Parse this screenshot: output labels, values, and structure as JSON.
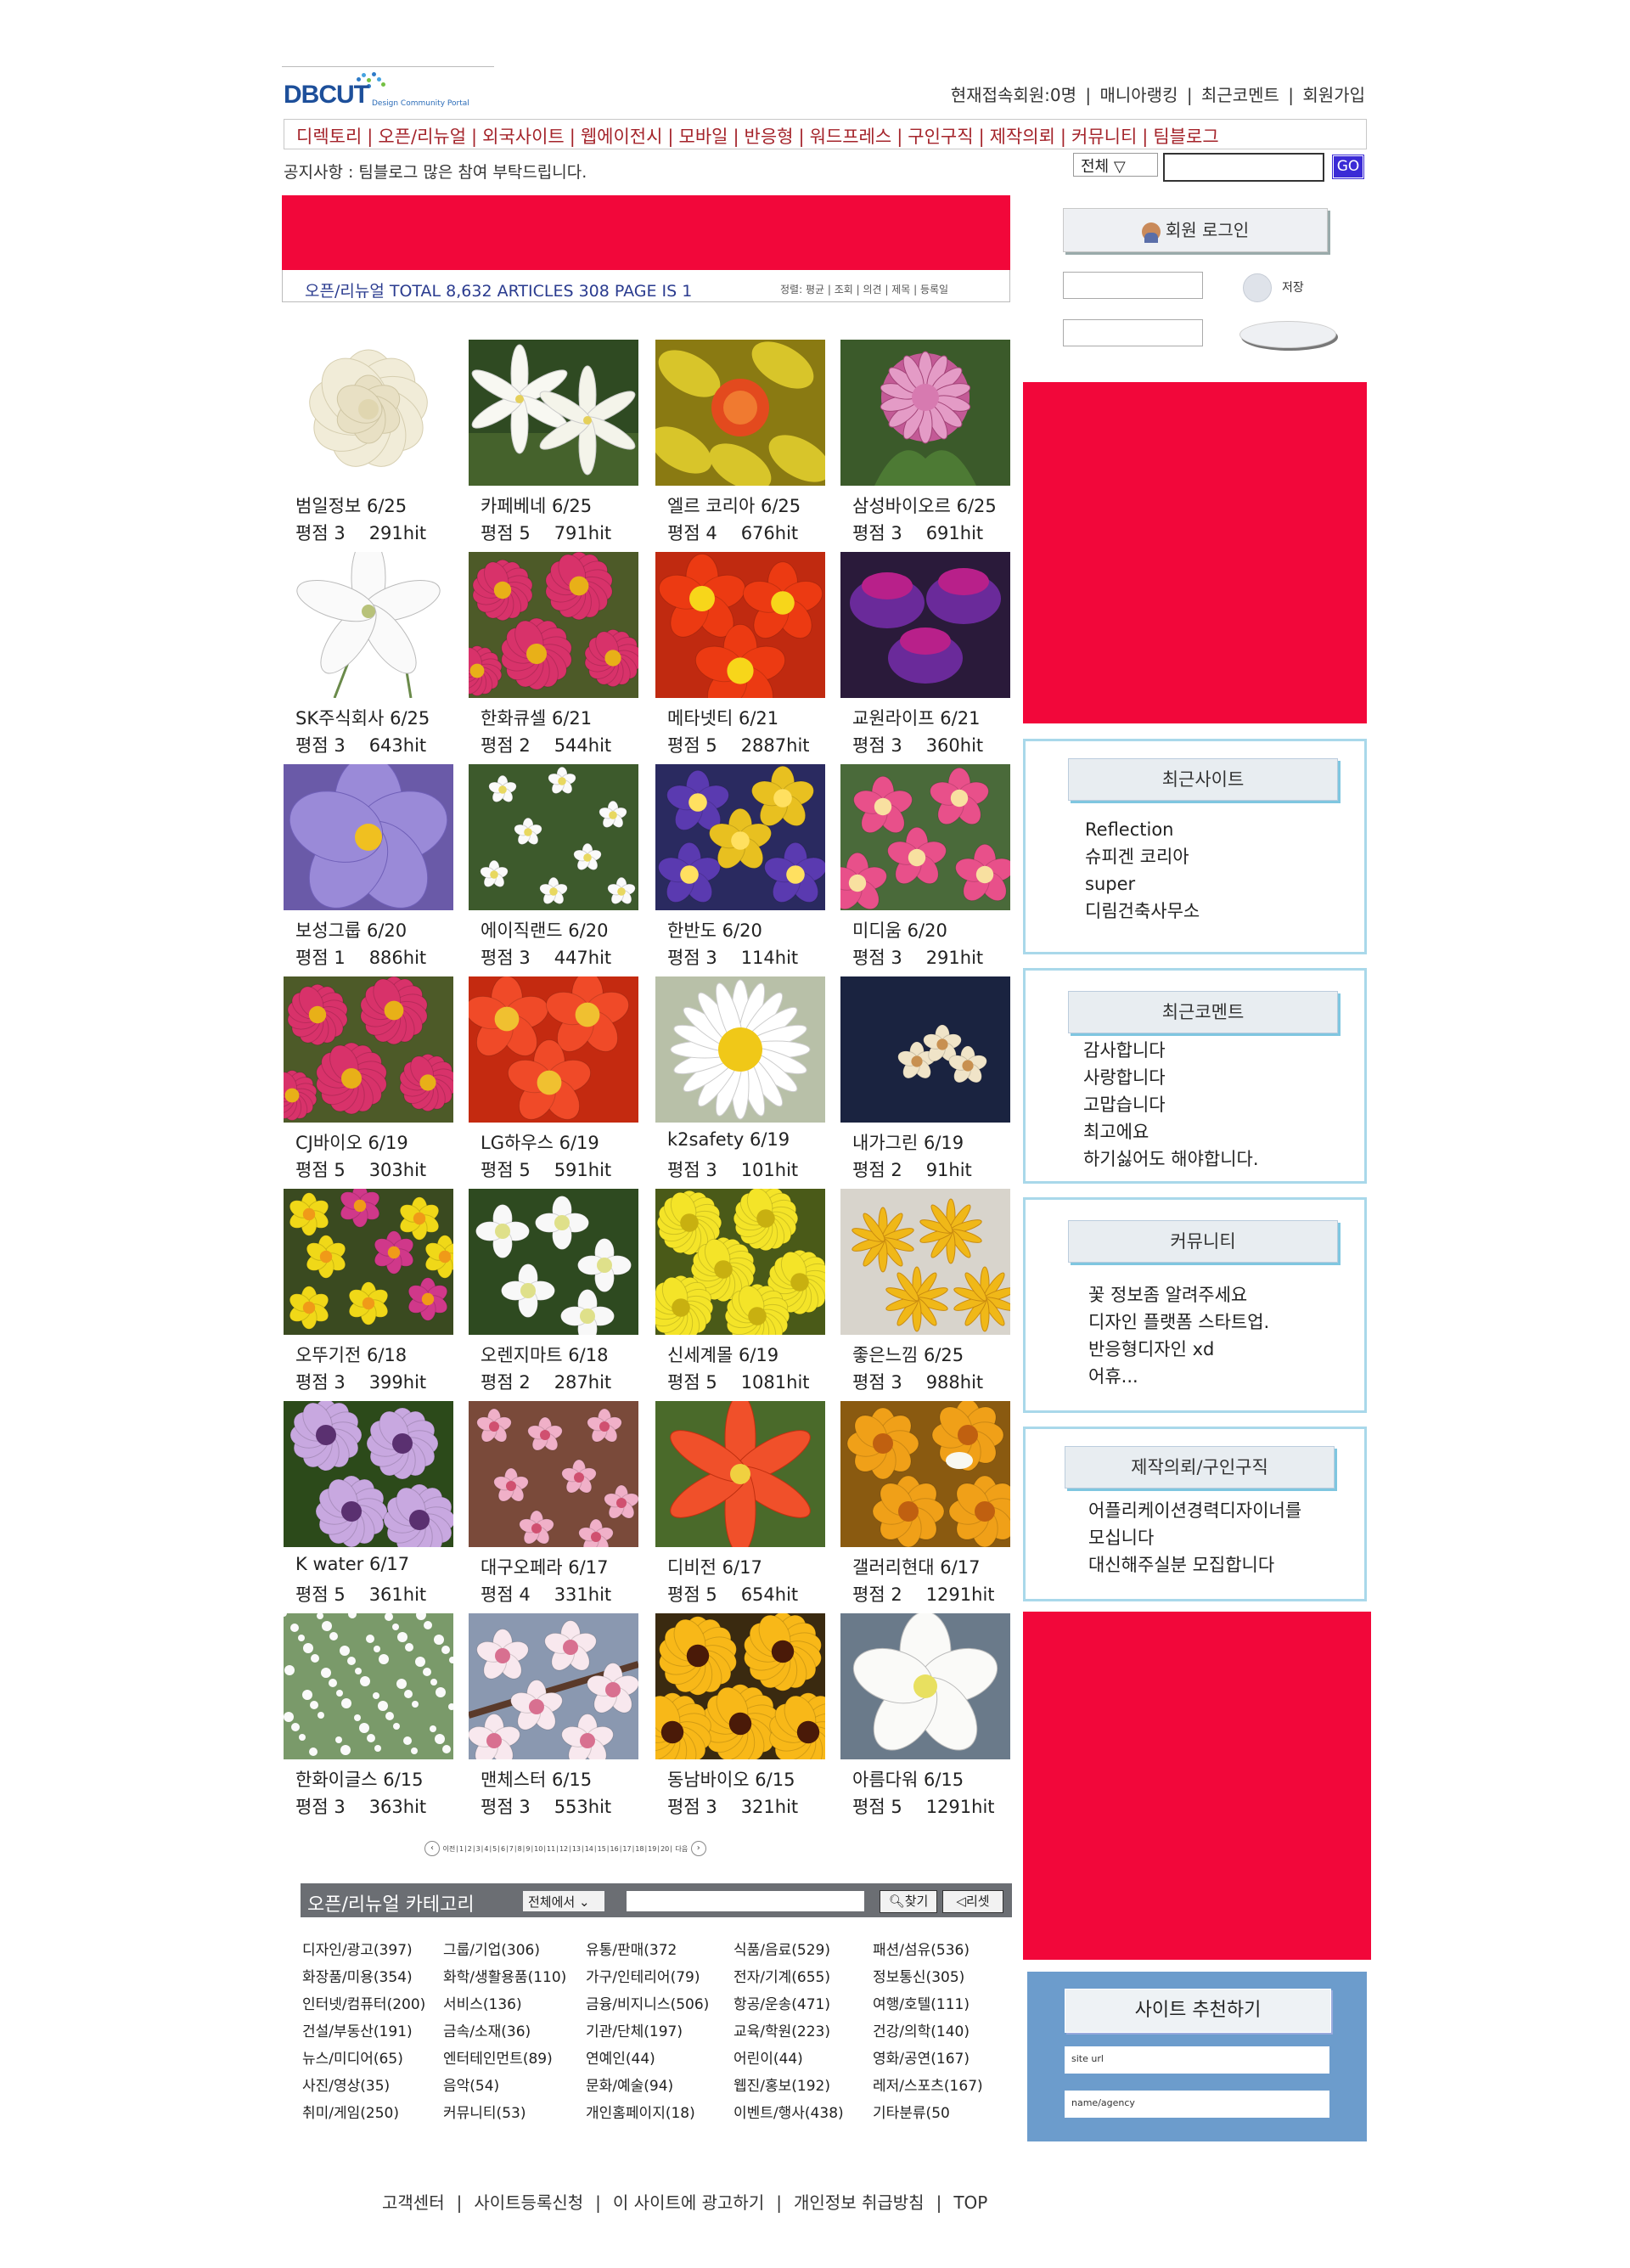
{
  "header": {
    "logo_text": "DBCUT",
    "logo_sub": "Design Community Portal",
    "top_links": [
      "현재접속회원:0명",
      "매니아랭킹",
      "최근코멘트",
      "회원가입"
    ],
    "nav": [
      "디렉토리",
      "오픈/리뉴얼",
      "외국사이트",
      "웹에이전시",
      "모바일",
      "반응형",
      "워드프레스",
      "구인구직",
      "제작의뢰",
      "커뮤니티",
      "팀블로그"
    ],
    "notice": "공지사항 : 팀블로그 많은 참여 부탁드립니다.",
    "search_select": "전체  ▽",
    "search_button": "GO"
  },
  "listbar": {
    "text": "오픈/리뉴얼   TOTAL 8,632   ARTICLES   308   PAGE IS   1",
    "sort": "정렬: 평균 | 조회 | 의견 | 제목 | 등록일"
  },
  "colors": {
    "banner_red": "#f2073a",
    "nav_red": "#a4232a",
    "box_border": "#a9d8ea",
    "recommend_bg": "#6c9ccc"
  },
  "login": {
    "button": "회원 로그인",
    "save_label": "저장"
  },
  "gallery": [
    {
      "name": "범일정보",
      "date": "6/25",
      "score": "평점 3",
      "hits": "291hit",
      "photo": "white-rose"
    },
    {
      "name": "카페베네",
      "date": "6/25",
      "score": "평점 5",
      "hits": "791hit",
      "photo": "white-lily"
    },
    {
      "name": "엘르 코리아",
      "date": "6/25",
      "score": "평점 4",
      "hits": "676hit",
      "photo": "yellow-leaves"
    },
    {
      "name": "삼성바이오르",
      "date": "6/25",
      "score": "평점 3",
      "hits": "691hit",
      "photo": "pink-clover"
    },
    {
      "name": "SK주식회사",
      "date": "6/25",
      "score": "평점 3",
      "hits": "643hit",
      "photo": "white-star"
    },
    {
      "name": "한화큐셀",
      "date": "6/21",
      "score": "평점 2",
      "hits": "544hit",
      "photo": "pink-daisies"
    },
    {
      "name": "메타넷티",
      "date": "6/21",
      "score": "평점 5",
      "hits": "2887hit",
      "photo": "orange-primrose"
    },
    {
      "name": "교원라이프",
      "date": "6/21",
      "score": "평점 3",
      "hits": "360hit",
      "photo": "purple-fuchsia"
    },
    {
      "name": "보성그룹",
      "date": "6/20",
      "score": "평점 1",
      "hits": "886hit",
      "photo": "lilac-flower"
    },
    {
      "name": "에이직랜드",
      "date": "6/20",
      "score": "평점 3",
      "hits": "447hit",
      "photo": "tiny-white"
    },
    {
      "name": "한반도",
      "date": "6/20",
      "score": "평점 3",
      "hits": "114hit",
      "photo": "pansies"
    },
    {
      "name": "미디움",
      "date": "6/20",
      "score": "평점 3",
      "hits": "291hit",
      "photo": "pink-blossom"
    },
    {
      "name": "CJ바이오",
      "date": "6/19",
      "score": "평점 5",
      "hits": "303hit",
      "photo": "pink-daisies"
    },
    {
      "name": "LG하우스",
      "date": "6/19",
      "score": "평점 5",
      "hits": "591hit",
      "photo": "red-quince"
    },
    {
      "name": "k2safety",
      "date": "6/19",
      "score": "평점 3",
      "hits": "101hit",
      "photo": "white-daisy"
    },
    {
      "name": "내가그린",
      "date": "6/19",
      "score": "평점 2",
      "hits": "91hit",
      "photo": "dark-small"
    },
    {
      "name": "오뚜기전",
      "date": "6/18",
      "score": "평점 3",
      "hits": "399hit",
      "photo": "yellow-field"
    },
    {
      "name": "오렌지마트",
      "date": "6/18",
      "score": "평점 2",
      "hits": "287hit",
      "photo": "white-cress"
    },
    {
      "name": "신세계몰",
      "date": "6/19",
      "score": "평점 5",
      "hits": "1081hit",
      "photo": "yellow-mums"
    },
    {
      "name": "좋은느낌",
      "date": "6/25",
      "score": "평점 3",
      "hits": "988hit",
      "photo": "yellow-allium"
    },
    {
      "name": "K water",
      "date": "6/17",
      "score": "평점 5",
      "hits": "361hit",
      "photo": "osteospermum"
    },
    {
      "name": "대구오페라",
      "date": "6/17",
      "score": "평점 4",
      "hits": "331hit",
      "photo": "peach-blossom"
    },
    {
      "name": "디비전",
      "date": "6/17",
      "score": "평점 5",
      "hits": "654hit",
      "photo": "red-star"
    },
    {
      "name": "갤러리현대",
      "date": "6/17",
      "score": "평점 2",
      "hits": "1291hit",
      "photo": "orange-cosmos"
    },
    {
      "name": "한화이글스",
      "date": "6/15",
      "score": "평점 3",
      "hits": "363hit",
      "photo": "babys-breath"
    },
    {
      "name": "맨체스터",
      "date": "6/15",
      "score": "평점 3",
      "hits": "553hit",
      "photo": "cherry-blossom"
    },
    {
      "name": "동남바이오",
      "date": "6/15",
      "score": "평점 3",
      "hits": "321hit",
      "photo": "black-eyed-susan"
    },
    {
      "name": "아름다워",
      "date": "6/15",
      "score": "평점 5",
      "hits": "1291hit",
      "photo": "white-jasmine"
    }
  ],
  "pager": {
    "prev": "이전",
    "next": "다음",
    "pages": [
      "1",
      "2",
      "3",
      "4",
      "5",
      "6",
      "7",
      "8",
      "9",
      "10",
      "11",
      "12",
      "13",
      "14",
      "15",
      "16",
      "17",
      "18",
      "19",
      "20"
    ]
  },
  "category": {
    "title": "오픈/리뉴얼 카테고리",
    "select": "전체에서",
    "find_button": "찾기",
    "reset_button": "리셋",
    "items": [
      [
        "디자인/광고(397)",
        "그룹/기업(306)",
        "유통/판매(372",
        "식품/음료(529)",
        "패션/섬유(536)"
      ],
      [
        "화장품/미용(354)",
        "화학/생활용품(110)",
        "가구/인테리어(79)",
        "전자/기계(655)",
        "정보통신(305)"
      ],
      [
        "인터넷/컴퓨터(200)",
        "서비스(136)",
        "금융/비지니스(506)",
        "항공/운송(471)",
        "여행/호텔(111)"
      ],
      [
        "건설/부동산(191)",
        "금속/소재(36)",
        "기관/단체(197)",
        "교육/학원(223)",
        "건강/의학(140)"
      ],
      [
        "뉴스/미디어(65)",
        "엔터테인먼트(89)",
        "연예인(44)",
        "어린이(44)",
        "영화/공연(167)"
      ],
      [
        "사진/영상(35)",
        "음악(54)",
        "문화/예술(94)",
        "웹진/홍보(192)",
        "레저/스포츠(167)"
      ],
      [
        "취미/게임(250)",
        "커뮤니티(53)",
        "개인홈페이지(18)",
        "이벤트/행사(438)",
        "기타분류(50"
      ]
    ]
  },
  "sidebar": {
    "recent_sites": {
      "title": "최근사이트",
      "items": [
        "Reflection",
        "슈피겐 코리아",
        "super",
        "디림건축사무소"
      ]
    },
    "recent_comments": {
      "title": "최근코멘트",
      "items": [
        "감사합니다",
        "사랑합니다",
        "고맙습니다",
        "최고에요",
        "하기싫어도 해야합니다."
      ]
    },
    "community": {
      "title": "커뮤니티",
      "items": [
        "꽃 정보좀 알려주세요",
        "디자인 플랫폼 스타트업.",
        "반응형디자인 xd",
        "어휴..."
      ]
    },
    "request": {
      "title": "제작의뢰/구인구직",
      "items": [
        "어플리케이션경력디자이너를",
        "모십니다",
        "대신해주실분 모집합니다"
      ]
    },
    "recommend": {
      "title": "사이트 추천하기",
      "site_url": "site url",
      "name_agency": "name/agency"
    }
  },
  "footer": [
    "고객센터",
    "사이트등록신청",
    "이 사이트에 광고하기",
    "개인정보 취급방침",
    "TOP"
  ]
}
